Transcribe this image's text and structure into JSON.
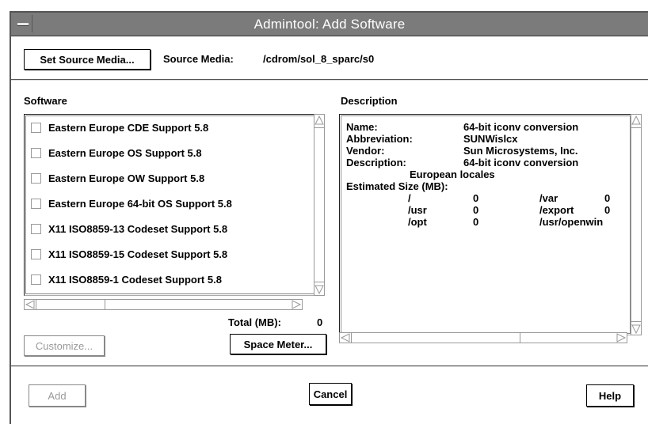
{
  "window": {
    "title": "Admintool: Add Software"
  },
  "source": {
    "set_button": "Set Source Media...",
    "label": "Source Media:",
    "value": "/cdrom/sol_8_sparc/s0"
  },
  "software": {
    "header": "Software",
    "items": [
      {
        "label": "Eastern Europe CDE Support 5.8",
        "checked": false
      },
      {
        "label": "Eastern Europe OS Support 5.8",
        "checked": false
      },
      {
        "label": "Eastern Europe OW Support 5.8",
        "checked": false
      },
      {
        "label": "Eastern Europe 64-bit OS Support 5.8",
        "checked": false
      },
      {
        "label": "X11 ISO8859-13 Codeset Support 5.8",
        "checked": false
      },
      {
        "label": "X11 ISO8859-15 Codeset Support 5.8",
        "checked": false
      },
      {
        "label": "X11 ISO8859-1 Codeset Support 5.8",
        "checked": false
      }
    ],
    "total_label": "Total (MB):",
    "total_value": "0",
    "customize_button": "Customize...",
    "space_meter_button": "Space Meter..."
  },
  "description": {
    "header": "Description",
    "name_label": "Name:",
    "name_value": "64-bit iconv conversion",
    "abbrev_label": "Abbreviation:",
    "abbrev_value": "SUNWislcx",
    "vendor_label": "Vendor:",
    "vendor_value": "Sun Microsystems, Inc.",
    "desc_label": "Description:",
    "desc_value": "64-bit iconv conversion",
    "desc_cont": "European locales",
    "size_label": "Estimated Size (MB):",
    "sizes": [
      {
        "path": "/",
        "size": "0",
        "path2": "/var",
        "size2": "0"
      },
      {
        "path": "/usr",
        "size": "0",
        "path2": "/export",
        "size2": "0"
      },
      {
        "path": "/opt",
        "size": "0",
        "path2": "/usr/openwin",
        "size2": ""
      }
    ]
  },
  "footer": {
    "add_button": "Add",
    "cancel_button": "Cancel",
    "help_button": "Help"
  }
}
